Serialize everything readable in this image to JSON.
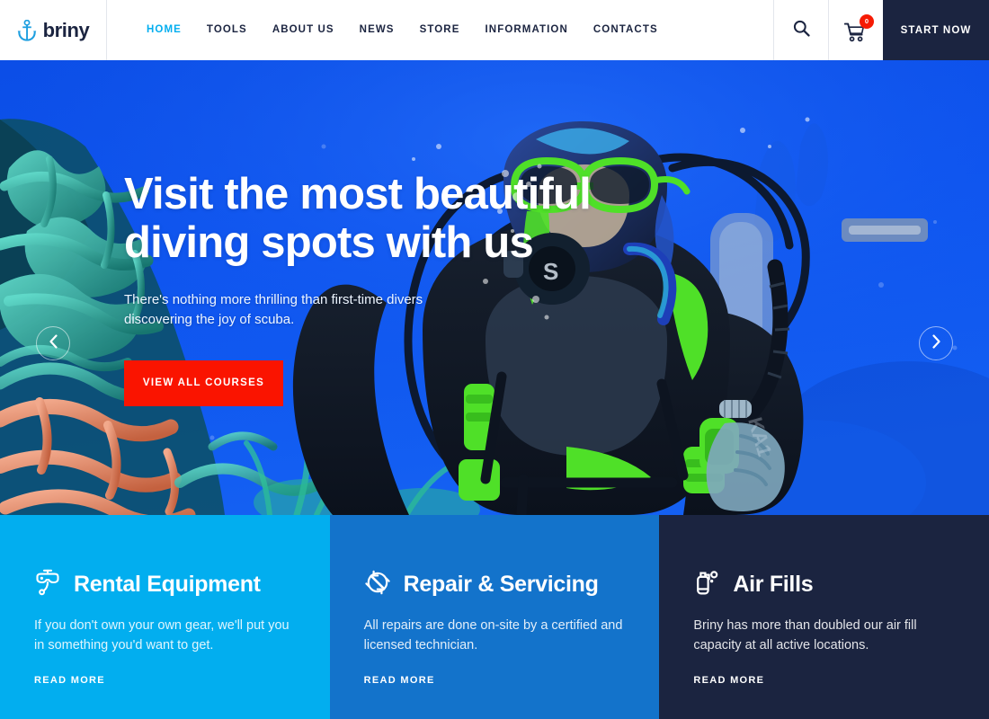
{
  "header": {
    "logo_text": "briny",
    "logo_icon": "anchor-icon",
    "nav": [
      {
        "label": "HOME",
        "active": true
      },
      {
        "label": "TOOLS",
        "active": false
      },
      {
        "label": "ABOUT US",
        "active": false
      },
      {
        "label": "NEWS",
        "active": false
      },
      {
        "label": "STORE",
        "active": false
      },
      {
        "label": "INFORMATION",
        "active": false
      },
      {
        "label": "CONTACTS",
        "active": false
      }
    ],
    "search_icon": "search-icon",
    "cart_icon": "shopping-cart-icon",
    "cart_count": "0",
    "start_now_label": "START NOW"
  },
  "hero": {
    "title": "Visit the most beautiful diving spots with us",
    "subtitle": "There's nothing more thrilling than first-time divers discovering the joy of scuba.",
    "cta_label": "VIEW ALL COURSES",
    "prev_icon": "chevron-left-icon",
    "next_icon": "chevron-right-icon",
    "image_alt": "scuba diver underwater with coral reef"
  },
  "features": [
    {
      "icon": "diving-mask-icon",
      "title": "Rental Equipment",
      "description": "If you don't own your own gear, we'll put you in something you'd want to get.",
      "link_label": "READ MORE"
    },
    {
      "icon": "wrench-repair-icon",
      "title": "Repair & Servicing",
      "description": "All repairs are done on-site by a certified and licensed technician.",
      "link_label": "READ MORE"
    },
    {
      "icon": "air-tank-icon",
      "title": "Air Fills",
      "description": "Briny has more than doubled our air fill capacity at all active locations.",
      "link_label": "READ MORE"
    }
  ],
  "colors": {
    "accent_cyan": "#02aeef",
    "accent_blue": "#1373cb",
    "dark_navy": "#1b2440",
    "cta_red": "#fa1400",
    "badge_red": "#f61b04",
    "white": "#ffffff"
  }
}
